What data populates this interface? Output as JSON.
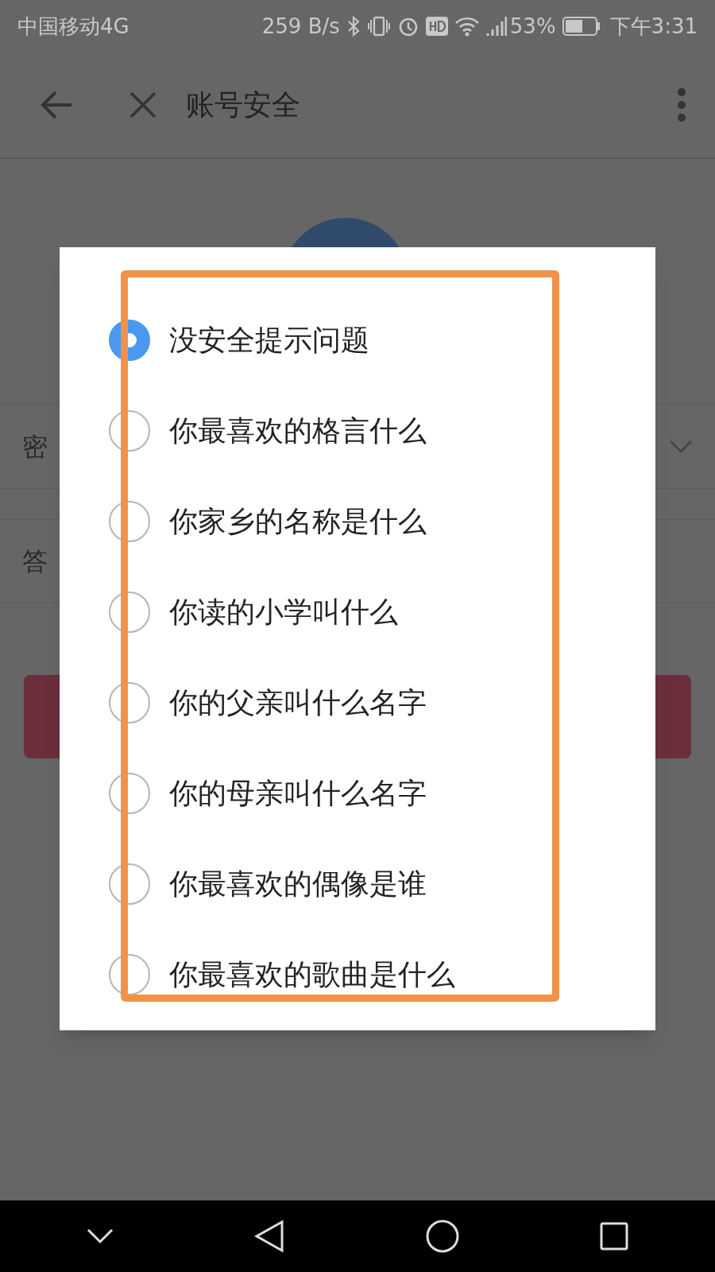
{
  "status_bar": {
    "carrier": "中国移动4G",
    "speed": "259 B/s",
    "battery": "53%",
    "time": "下午3:31"
  },
  "toolbar": {
    "title": "账号安全"
  },
  "form": {
    "rows": [
      {
        "label": "密"
      },
      {
        "label": "答"
      }
    ]
  },
  "dialog": {
    "options": [
      {
        "label": "没安全提示问题",
        "selected": true
      },
      {
        "label": "你最喜欢的格言什么",
        "selected": false
      },
      {
        "label": "你家乡的名称是什么",
        "selected": false
      },
      {
        "label": "你读的小学叫什么",
        "selected": false
      },
      {
        "label": "你的父亲叫什么名字",
        "selected": false
      },
      {
        "label": "你的母亲叫什么名字",
        "selected": false
      },
      {
        "label": "你最喜欢的偶像是谁",
        "selected": false
      },
      {
        "label": "你最喜欢的歌曲是什么",
        "selected": false
      }
    ]
  }
}
